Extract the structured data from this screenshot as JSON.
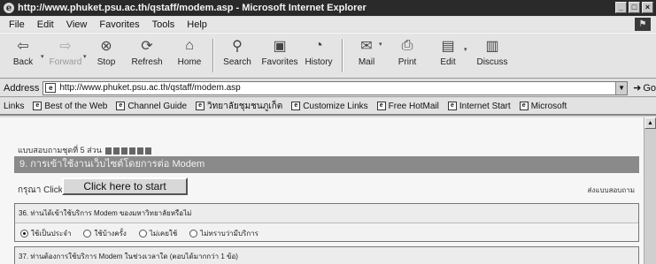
{
  "window": {
    "title": "http://www.phuket.psu.ac.th/qstaff/modem.asp - Microsoft Internet Explorer",
    "buttons": [
      "_",
      "□",
      "×"
    ]
  },
  "menu": {
    "items": [
      "File",
      "Edit",
      "View",
      "Favorites",
      "Tools",
      "Help"
    ]
  },
  "toolbar": {
    "back": "Back",
    "forward": "Forward",
    "stop": "Stop",
    "refresh": "Refresh",
    "home": "Home",
    "search": "Search",
    "favorites": "Favorites",
    "history": "History",
    "mail": "Mail",
    "print": "Print",
    "edit": "Edit",
    "discuss": "Discuss"
  },
  "address": {
    "label": "Address",
    "url": "http://www.phuket.psu.ac.th/qstaff/modem.asp",
    "go": "Go"
  },
  "links": {
    "label": "Links",
    "items": [
      "Best of the Web",
      "Channel Guide",
      "วิทยาลัยชุมชนภูเก็ต",
      "Customize Links",
      "Free HotMail",
      "Internet Start",
      "Microsoft"
    ]
  },
  "page": {
    "crumb": "แบบสอบถามชุดที่ 5 ส่วน",
    "section_title": "9. การเข้าใช้งานเว็บไซต์โดยการต่อ Modem",
    "please_click": "กรุณา Click",
    "start_button": "Click here to start",
    "right_note": "ส่งแบบสอบถาม",
    "q36_title": "36. ท่านได้เข้าใช้บริการ Modem ของมหาวิทยาลัยหรือไม่",
    "q36_options": [
      "ใช้เป็นประจำ",
      "ใช้บ้างครั้ง",
      "ไม่เคยใช้",
      "ไม่ทราบว่ามีบริการ"
    ],
    "q37_title": "37. ท่านต้องการใช้บริการ Modem ในช่วงเวลาใด (ตอบได้มากกว่า 1 ข้อ)"
  }
}
